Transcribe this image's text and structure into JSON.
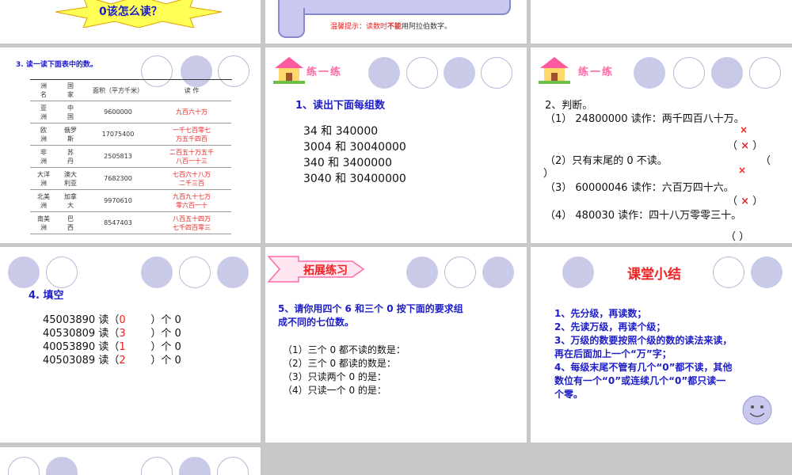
{
  "slide1": {
    "question": "0该怎么读？"
  },
  "slide2": {
    "tip_prefix": "温馨提示：读数时",
    "tip_highlight": "不能",
    "tip_suffix": "用阿拉伯数字。"
  },
  "slide4": {
    "title": "3.  读一读下面表中的数。",
    "headers": [
      "洲\n名",
      "国\n家",
      "面积（平方千米）",
      "读  作"
    ],
    "rows": [
      [
        "亚\n洲",
        "中\n国",
        "9600000",
        "九百六十万"
      ],
      [
        "欧\n洲",
        "俄罗\n斯",
        "17075400",
        "一千七百零七\n万五千四百"
      ],
      [
        "非\n洲",
        "苏\n丹",
        "2505813",
        "二百五十万五千\n八百一十三"
      ],
      [
        "大洋\n洲",
        "澳大\n利亚",
        "7682300",
        "七百六十八万\n二千三百"
      ],
      [
        "北美\n洲",
        "加拿\n大",
        "9970610",
        "九百九十七万\n零六百一十"
      ],
      [
        "南美\n洲",
        "巴\n西",
        "8547403",
        "八百五十四万\n七千四百零三"
      ]
    ]
  },
  "slide5": {
    "banner": "练一练",
    "heading": "1、读出下面每组数",
    "pairs": [
      "34 和 340000",
      "3004 和 30040000",
      "340 和 3400000",
      "3040 和 30400000"
    ]
  },
  "slide6": {
    "banner": "练一练",
    "heading": "2、判断。",
    "item1": "（1） 24800000  读作：两千四百八十万。",
    "item2": "（2）只有末尾的 0 不读。",
    "item3": "（3） 60000046  读作：六百万四十六。",
    "item4": "（4） 480030  读作：四十八万零零三十。",
    "paren_open": "（",
    "paren_close": "）",
    "empty_parens": "（      ）",
    "mark": "×"
  },
  "slide7": {
    "heading": "4. 填空",
    "rows": [
      {
        "num": "45003890",
        "read": "读（",
        "ans": "0",
        "tail": "）个 0"
      },
      {
        "num": "40530809",
        "read": "读（",
        "ans": "3",
        "tail": "）个 0"
      },
      {
        "num": "40053890",
        "read": "读（",
        "ans": "1",
        "tail": "）个 0"
      },
      {
        "num": "40503089",
        "read": "读（",
        "ans": "2",
        "tail": "）个 0"
      }
    ]
  },
  "slide8": {
    "banner": "拓展练习",
    "question_line1": "5、请你用四个 6 和三个 0 按下面的要求组",
    "question_line2": "成不同的七位数。",
    "items": [
      "（1）三个 0 都不读的数是：",
      "（2）三个 0 都读的数是：",
      "（3）只读两个 0 的是：",
      "（4）只读一个 0 的是："
    ]
  },
  "slide9": {
    "title": "课堂小结",
    "lines": [
      "1、先分级，再读数；",
      "2、先读万级，再读个级；",
      "3、万级的数要按照个级的数的读法来读，",
      "再在后面加上一个“万”字；",
      "4、每级末尾不管有几个“0”都不读，其他",
      "数位有一个“0”或连续几个“0”都只读一",
      "个零。"
    ]
  },
  "colors": {
    "accent_blue": "#1d1dc8",
    "accent_red": "#e22222",
    "circle": "#c9c9e8",
    "star": "#ffff55"
  }
}
